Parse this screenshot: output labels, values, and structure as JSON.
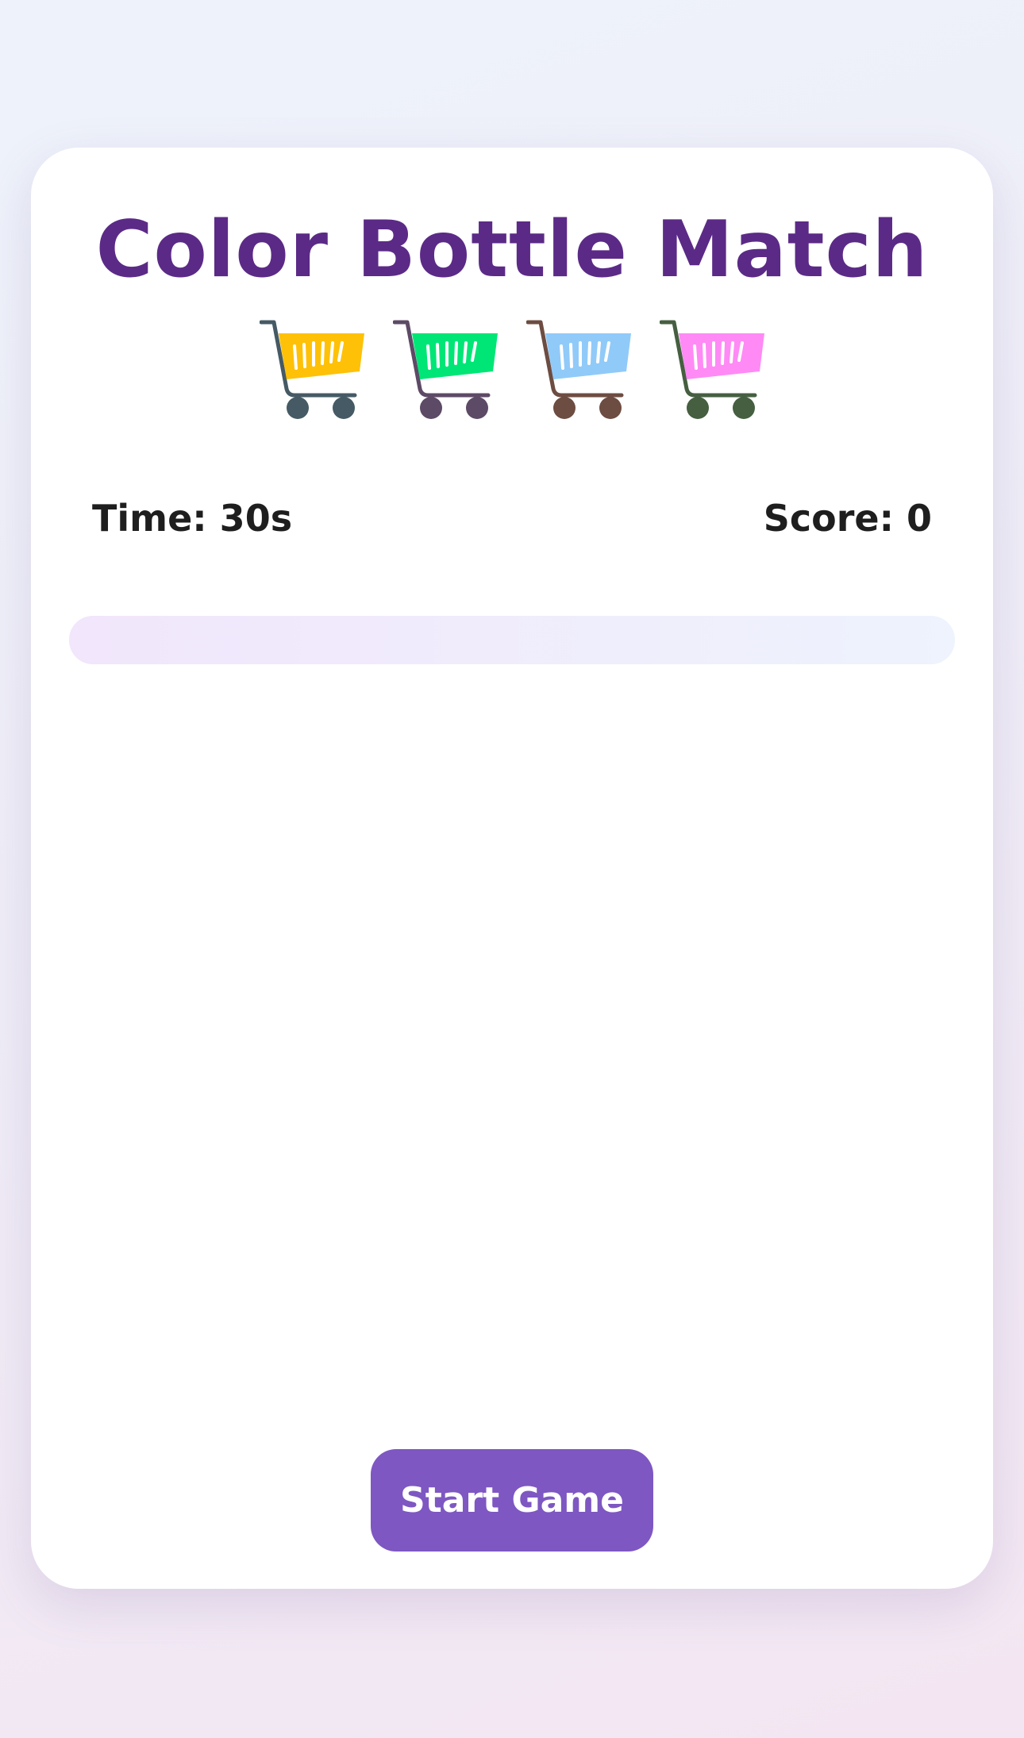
{
  "game": {
    "title": "Color Bottle Match",
    "time_label": "Time: 30s",
    "score_label": "Score: 0",
    "progress": 0,
    "start_button_label": "Start Game"
  },
  "carts": [
    {
      "icon": "shopping-cart-icon",
      "basket_color": "#ffc107",
      "frame_color": "#455a64"
    },
    {
      "icon": "shopping-cart-icon",
      "basket_color": "#00e676",
      "frame_color": "#5d4a66"
    },
    {
      "icon": "shopping-cart-icon",
      "basket_color": "#90caf9",
      "frame_color": "#6d4c41"
    },
    {
      "icon": "shopping-cart-icon",
      "basket_color": "#ff8af5",
      "frame_color": "#455f40"
    }
  ],
  "colors": {
    "title": "#5b2a86",
    "accent": "#7e57c2",
    "text": "#1e1e1e"
  }
}
